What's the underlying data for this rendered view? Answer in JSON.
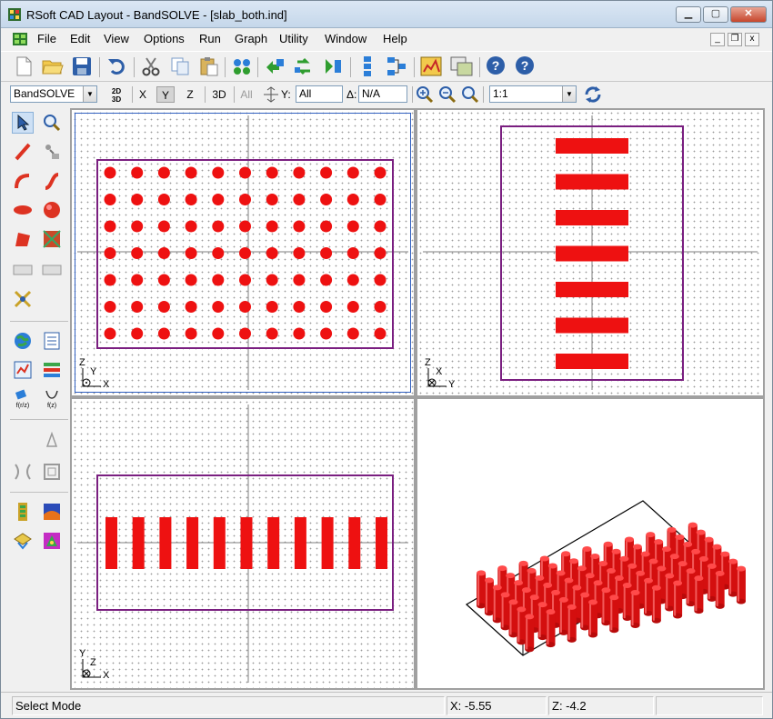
{
  "window": {
    "title": "RSoft CAD Layout - BandSOLVE - [slab_both.ind]"
  },
  "menu": [
    "File",
    "Edit",
    "View",
    "Options",
    "Run",
    "Graph",
    "Utility",
    "Window",
    "Help"
  ],
  "toolbar2": {
    "program": "BandSOLVE",
    "button_2d3d": "2D\n3D",
    "axes": [
      "X",
      "Y",
      "Z"
    ],
    "axis_selected": "Y",
    "btn_3d": "3D",
    "btn_all": "All",
    "y_label": "Y:",
    "y_value": "All",
    "delta_label": "Δ:",
    "delta_value": "N/A",
    "zoom_value": "1:1"
  },
  "panes": {
    "xy_axes": {
      "v": "Z",
      "h": "X",
      "sub": "Y"
    },
    "yz_axes": {
      "v": "Z",
      "h": "Y",
      "sub": "X"
    },
    "xz_axes": {
      "v": "Y",
      "h": "X",
      "sub": "Z"
    }
  },
  "icons": [
    "new-file-icon",
    "open-folder-icon",
    "save-icon",
    "undo-icon",
    "cut-icon",
    "copy-icon",
    "paste-icon",
    "link-icon",
    "symmetry-icon",
    "rotate-icon",
    "flip-icon",
    "align-icon",
    "distribute-icon",
    "run-simulation-icon",
    "view-results-icon",
    "help-icon",
    "help-bandsolve-icon"
  ],
  "status": {
    "mode": "Select Mode",
    "x": "X: -5.55",
    "z": "Z: -4.2"
  },
  "colors": {
    "structure_red": "#ee1111",
    "boundary_purple": "#7a1f80",
    "axis_line": "#7f7f7f"
  }
}
